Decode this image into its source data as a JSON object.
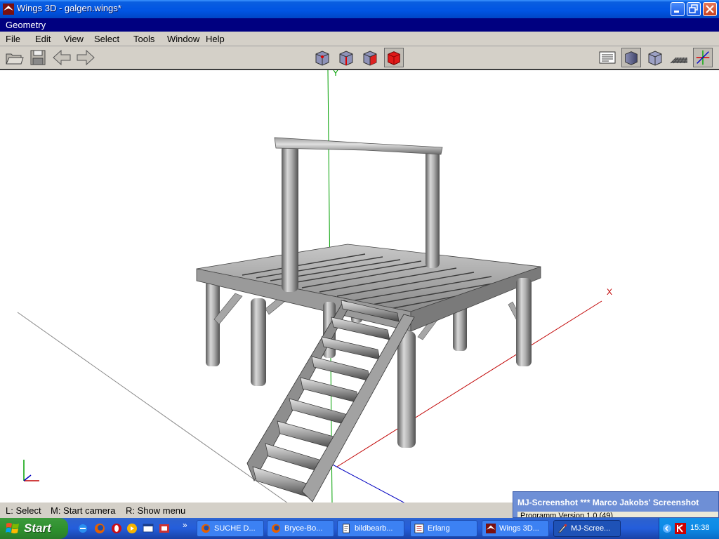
{
  "window": {
    "title": "Wings 3D - galgen.wings*",
    "min_icon": "minimize-icon",
    "max_icon": "restore-icon",
    "close_icon": "close-icon"
  },
  "geometry_bar": {
    "label": "Geometry"
  },
  "menu": [
    "File",
    "Edit",
    "View",
    "Select",
    "Tools",
    "Window",
    "Help"
  ],
  "toolbar": {
    "left": [
      "open-folder-icon",
      "save-icon",
      "undo-arrow-icon",
      "redo-arrow-icon"
    ],
    "selection_modes": [
      "vertex-mode-icon",
      "edge-mode-icon",
      "face-mode-icon",
      "body-mode-icon"
    ],
    "selected_mode": "body-mode-icon",
    "right": [
      "info-panel-icon",
      "smooth-shade-icon",
      "wireframe-shade-icon",
      "ground-plane-icon",
      "axes-icon"
    ]
  },
  "viewport": {
    "axis_y_label": "Y",
    "axis_x_label": "X",
    "colors": {
      "x_axis": "#c00000",
      "y_axis": "#00a000",
      "z_axis": "#0000c0"
    }
  },
  "status": {
    "left_hint": "L: Select",
    "middle_hint": "M: Start camera",
    "right_hint": "R: Show menu"
  },
  "notification": {
    "title": "MJ-Screenshot   ***   Marco Jakobs' Screenshot",
    "body": "Programm Version 1.0  (49)"
  },
  "taskbar": {
    "start_label": "Start",
    "quick_launch": [
      "ie-icon",
      "firefox-icon",
      "opera-icon",
      "media-player-icon",
      "show-desktop-icon",
      "screenshot-icon"
    ],
    "overflow": "»",
    "tasks": [
      {
        "label": "SUCHE D...",
        "icon": "firefox-icon"
      },
      {
        "label": "Bryce-Bo...",
        "icon": "firefox-icon"
      },
      {
        "label": "bildbearb...",
        "icon": "document-icon"
      },
      {
        "label": "Erlang",
        "icon": "erlang-icon"
      },
      {
        "label": "Wings 3D...",
        "icon": "wings-icon"
      },
      {
        "label": "MJ-Scree...",
        "icon": "screenshot-icon"
      }
    ],
    "clock": "15:38"
  }
}
